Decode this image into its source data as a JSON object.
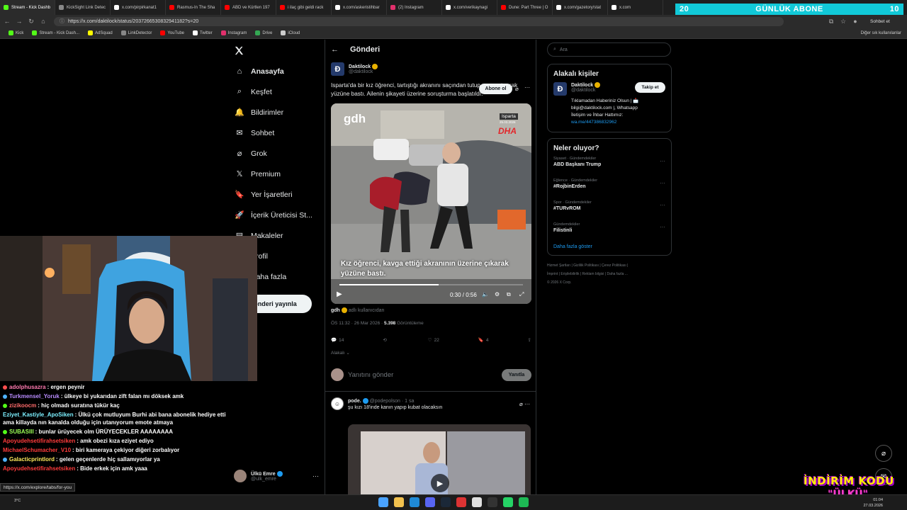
{
  "browser": {
    "tabs": [
      {
        "label": "Stream - Kick Dashb",
        "color": "#53fc18"
      },
      {
        "label": "KickSight Link Detec",
        "color": "#888888"
      },
      {
        "label": "x.com/pirpirkanat1",
        "color": "#ffffff"
      },
      {
        "label": "Rasmus-In The Sha",
        "color": "#ff0000"
      },
      {
        "label": "ABD ve Kürtlen 197",
        "color": "#ff0000"
      },
      {
        "label": "i ilaç gibi geldi rack",
        "color": "#ff0000"
      },
      {
        "label": "x.com/askeristihbar",
        "color": "#ffffff"
      },
      {
        "label": "(2) Instagram",
        "color": "#e1306c"
      },
      {
        "label": "x.com/verikaynagi",
        "color": "#ffffff"
      },
      {
        "label": "Dune: Part Three | O",
        "color": "#ff0000"
      },
      {
        "label": "x.com/gazetory/stat",
        "color": "#ffffff"
      },
      {
        "label": "x.com",
        "color": "#ffffff"
      }
    ],
    "url": "https://x.com/daktilock/status/2037266530832941182?s=20",
    "bookmarks": [
      {
        "label": "Kick",
        "color": "#53fc18"
      },
      {
        "label": "Stream - Kick Dash...",
        "color": "#53fc18"
      },
      {
        "label": "AdSquad",
        "color": "#fffc00"
      },
      {
        "label": "LinkDetector",
        "color": "#888888"
      },
      {
        "label": "YouTube",
        "color": "#ff0000"
      },
      {
        "label": "Twitter",
        "color": "#ffffff"
      },
      {
        "label": "Instagram",
        "color": "#e1306c"
      },
      {
        "label": "Drive",
        "color": "#34a853"
      },
      {
        "label": "iCloud",
        "color": "#cccccc"
      }
    ],
    "bookmarks_right": "Diğer sık kullanılanlar",
    "chat_button": "Sohbet et"
  },
  "subgoal": {
    "left": "20",
    "title": "GÜNLÜK ABONE",
    "right": "10"
  },
  "nav": {
    "items": [
      {
        "label": "Anasayfa",
        "icon": "home-icon"
      },
      {
        "label": "Keşfet",
        "icon": "search-icon"
      },
      {
        "label": "Bildirimler",
        "icon": "bell-icon"
      },
      {
        "label": "Sohbet",
        "icon": "mail-icon"
      },
      {
        "label": "Grok",
        "icon": "grok-icon"
      },
      {
        "label": "Premium",
        "icon": "x-premium-icon"
      },
      {
        "label": "Yer İşaretleri",
        "icon": "bookmark-icon"
      },
      {
        "label": "İçerik Üreticisi St...",
        "icon": "rocket-icon"
      },
      {
        "label": "Makaleler",
        "icon": "article-icon"
      },
      {
        "label": "Profil",
        "icon": "profile-icon"
      },
      {
        "label": "Daha fazla",
        "icon": "more-icon"
      }
    ],
    "post_button": "Gönderi yayınla",
    "profile": {
      "name": "Ülkü Emre",
      "handle": "@ulk_emre"
    }
  },
  "post": {
    "header": "Gönderi",
    "author_name": "Daktilock",
    "author_handle": "@daktilock",
    "subscribe": "Abone ol",
    "text": "Isparta'da bir kız öğrenci, tartıştığı akranını saçından tutup yere yatırarak yüzüne bastı.  Ailenin şikayeti üzerine soruşturma başlatıldı.",
    "video": {
      "badge_top": "Isparta",
      "badge_date": "25.03.2026",
      "watermark": "gdh",
      "dha": "DHA",
      "caption_line1": "Kız öğrenci, kavga ettiği akranının üzerine çıkarak",
      "caption_line2": "yüzüne bastı.",
      "time": "0:30 / 0:56"
    },
    "source_name": "gdh",
    "source_suffix": "adlı kullanıcıdan",
    "meta_time": "ÖS 11:32 · 26 Mar 2026 · ",
    "views": "5.398",
    "views_label": "Görüntüleme",
    "stats": {
      "replies": "14",
      "reposts": "",
      "likes": "22",
      "bookmarks": "4"
    },
    "relevance": "Alakalı",
    "reply_placeholder": "Yanıtını gönder",
    "reply_button": "Yanıtla"
  },
  "reply": {
    "name": "pode.",
    "handle": "@podepolson",
    "time": "· 1 sa",
    "text": "şu kızı 18'inde kanın yapıp kubat olacaksın"
  },
  "right": {
    "search_placeholder": "Ara",
    "related_title": "Alakalı kişiler",
    "related": {
      "name": "Daktilock",
      "handle": "@daktilock",
      "follow": "Takip et",
      "bio1": "Tıklamadan Haberiniz Olsun | 📩",
      "bio2": "bilgi@daktilock.com |, Whatsapp",
      "bio3": "İletişim ve İhbar Hattımız:",
      "link": "wa.me/447386832962"
    },
    "trends_title": "Neler oluyor?",
    "trends": [
      {
        "cat": "Siyaset · Gündemdekiler",
        "name": "ABD Başkanı Trump"
      },
      {
        "cat": "Eğlence · Gündemdekiler",
        "name": "#RojbinErden"
      },
      {
        "cat": "Spor · Gündemdekiler",
        "name": "#TURvROM"
      },
      {
        "cat": "Gündemdekiler",
        "name": "Filistinli"
      }
    ],
    "show_more": "Daha fazla göster",
    "footer1": "Hizmet Şartları  |  Gizlilik Politikası  |  Çerez Politikası  |",
    "footer2": "İmprint  |  Erişilebilirlik  |  Reklam bilgisi  |  Daha fazla ...",
    "footer3": "© 2026 X Corp."
  },
  "chat": [
    {
      "user": "adolphusazra",
      "text": ": ergen peynir",
      "color": "#ff7ab0",
      "badge": "#ff4f4f"
    },
    {
      "user": "Turkmensel_Yoruk",
      "text": ": ülkeye bi yukarıdan zift falan mı döksek amk",
      "color": "#b98cff",
      "badge": "#4fb3ff"
    },
    {
      "user": "zizikoocm",
      "text": ": hiç olmadı suratına tükür kaç",
      "color": "#ff6b6b",
      "badge": "#53fc18"
    },
    {
      "user": "Eziyet_Kastiyle_ApoSiken",
      "text": ": Ülkü çok mutluyum Burhi abi bana abonelik hediye etti ama killayda nın kanalda olduğu için utanıyorum emote atmaya",
      "color": "#7cf0ff",
      "badge": ""
    },
    {
      "user": "SUBASIII",
      "text": ": bunlar ürüyecek olm ÜRÜYECEKLER AAAAAAAA",
      "color": "#9cff57",
      "badge": "#53fc18"
    },
    {
      "user": "Apoyudehsetifirahsetsiken",
      "text": ": amk obezi kıza eziyet ediyo",
      "color": "#ff3b3b",
      "badge": ""
    },
    {
      "user": "MichaelSchumacher_V10",
      "text": ": biri kameraya çekiyor diğeri zorbalıyor",
      "color": "#ff3b3b",
      "badge": ""
    },
    {
      "user": "Galacticprintlord",
      "text": ": gelen geçenlerde hiç sallamıyorlar ya",
      "color": "#ffe95c",
      "badge": "#4fb3ff"
    },
    {
      "user": "Apoyudehsetifirahsetsiken",
      "text": ": Bide erkek için amk yaaa",
      "color": "#ff3b3b",
      "badge": ""
    }
  ],
  "statusbar_url": "https://x.com/explore/tabs/for-you",
  "taskbar": {
    "weather": "3°C",
    "time": "01:04",
    "date": "27.03.2026"
  },
  "promo": {
    "line1": "İNDİRİM KODU",
    "line2": "\"ÜLKÜ\""
  }
}
